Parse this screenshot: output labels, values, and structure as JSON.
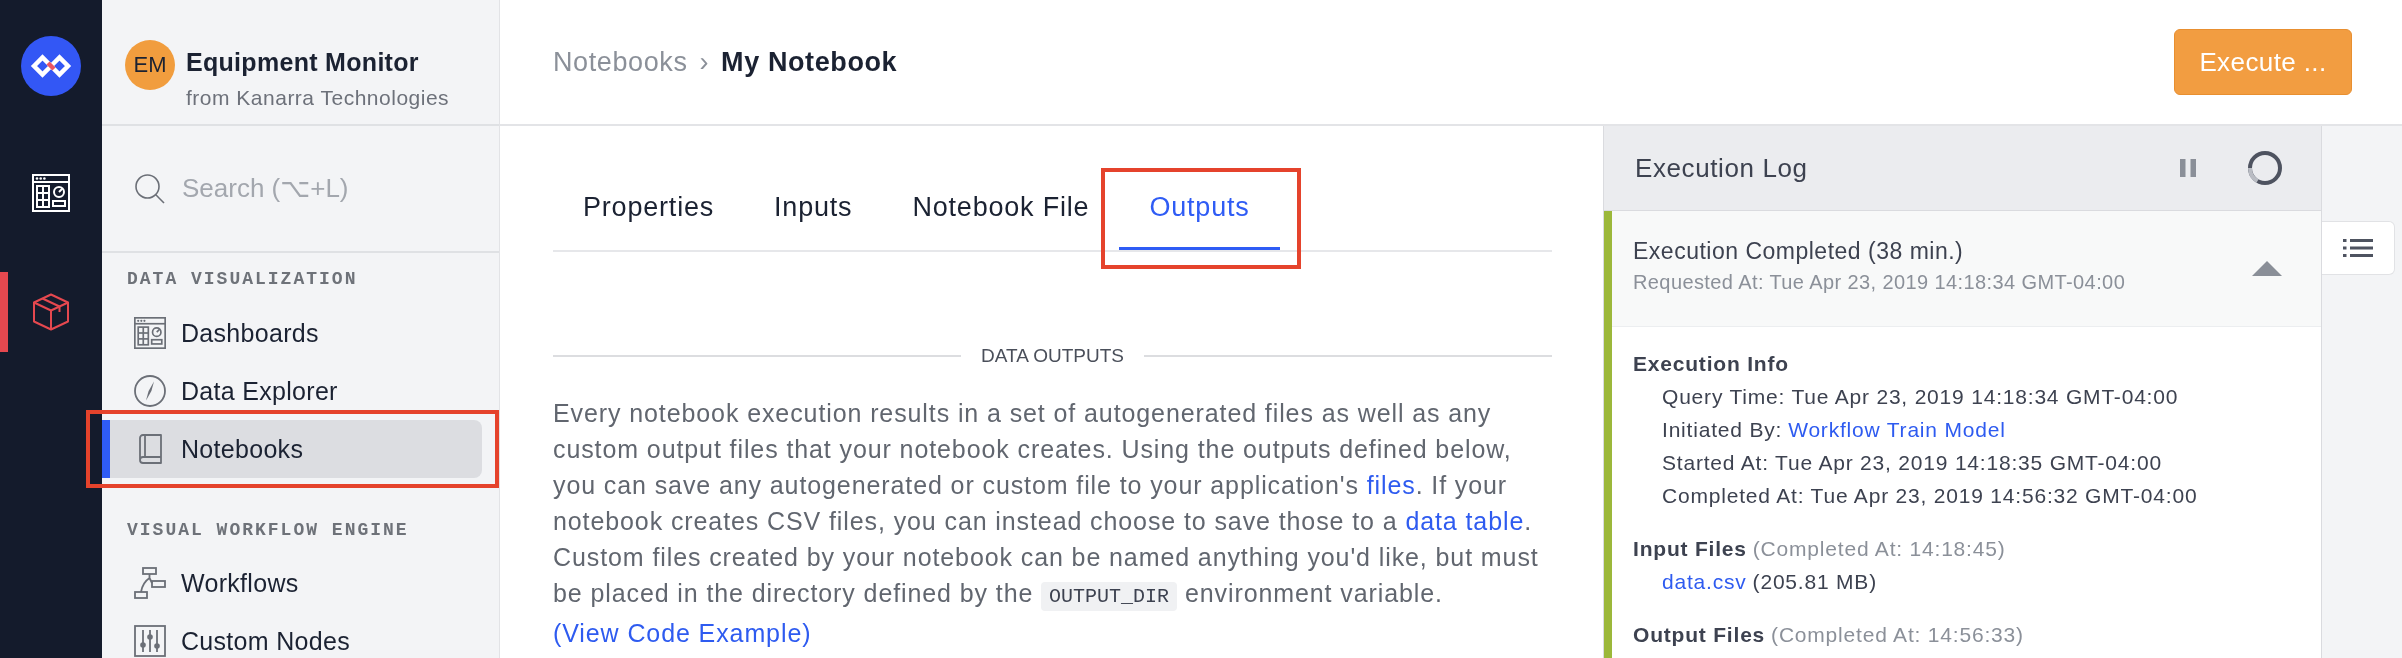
{
  "rail": {
    "items": [
      {
        "kind": "dashboard",
        "selected": false
      },
      {
        "kind": "cube",
        "selected": true
      }
    ]
  },
  "app": {
    "initials": "EM",
    "name": "Equipment Monitor",
    "owner": "from Kanarra Technologies"
  },
  "search": {
    "placeholder": "Search (⌥+L)"
  },
  "sidebar": {
    "sections": [
      {
        "title": "DATA VISUALIZATION",
        "items": [
          {
            "kind": "dashboard",
            "label": "Dashboards",
            "selected": false,
            "highlighted": false
          },
          {
            "kind": "compass",
            "label": "Data Explorer",
            "selected": false,
            "highlighted": false
          },
          {
            "kind": "book",
            "label": "Notebooks",
            "selected": true,
            "highlighted": true
          }
        ]
      },
      {
        "title": "VISUAL WORKFLOW ENGINE",
        "items": [
          {
            "kind": "workflow",
            "label": "Workflows",
            "selected": false,
            "highlighted": false
          },
          {
            "kind": "sliders",
            "label": "Custom Nodes",
            "selected": false,
            "highlighted": false
          }
        ]
      }
    ]
  },
  "breadcrumb": {
    "parent": "Notebooks",
    "separator": "›",
    "current": "My Notebook"
  },
  "execute_button": {
    "label": "Execute ..."
  },
  "tabs": [
    {
      "label": "Properties",
      "selected": false,
      "highlighted": false
    },
    {
      "label": "Inputs",
      "selected": false,
      "highlighted": false
    },
    {
      "label": "Notebook File",
      "selected": false,
      "highlighted": false
    },
    {
      "label": "Outputs",
      "selected": true,
      "highlighted": true
    }
  ],
  "section": {
    "title": "DATA OUTPUTS",
    "description": [
      {
        "kind": "text",
        "text": "Every notebook execution results in a set of autogenerated files as well as any custom output files that your notebook creates. Using the outputs defined below, you can save any autogenerated or custom file to your application's "
      },
      {
        "kind": "link",
        "text": "files"
      },
      {
        "kind": "text",
        "text": ". If your notebook creates CSV files, you can instead choose to save those to a "
      },
      {
        "kind": "link",
        "text": "data table"
      },
      {
        "kind": "text",
        "text": ". Custom files created by your notebook can be named anything you'd like, but must be placed in the directory defined by the "
      },
      {
        "kind": "code",
        "text": "OUTPUT_DIR"
      },
      {
        "kind": "text",
        "text": " environment variable. "
      },
      {
        "kind": "link",
        "text": "(View Code Example)"
      }
    ]
  },
  "execution_log": {
    "title": "Execution Log",
    "entries": [
      {
        "status": "Execution Completed (38 min.)",
        "requested": "Requested At: Tue Apr 23, 2019 14:18:34 GMT-04:00",
        "color": "#9cb83a",
        "expanded": true,
        "info_title": "Execution Info",
        "details": [
          {
            "kind": "text",
            "text": "Query Time: Tue Apr 23, 2019 14:18:34 GMT-04:00"
          },
          {
            "kind": "link",
            "label": "Initiated By:",
            "link": "Workflow Train Model"
          },
          {
            "kind": "text",
            "text": "Started At: Tue Apr 23, 2019 14:18:35 GMT-04:00"
          },
          {
            "kind": "text",
            "text": "Completed At: Tue Apr 23, 2019 14:56:32 GMT-04:00"
          }
        ],
        "file_groups": [
          {
            "title": "Input Files",
            "note": "(Completed At: 14:18:45)",
            "files": [
              {
                "name": "data.csv",
                "size": "(205.81 MB)"
              }
            ]
          },
          {
            "title": "Output Files",
            "note": "(Completed At: 14:56:33)"
          }
        ]
      }
    ]
  }
}
